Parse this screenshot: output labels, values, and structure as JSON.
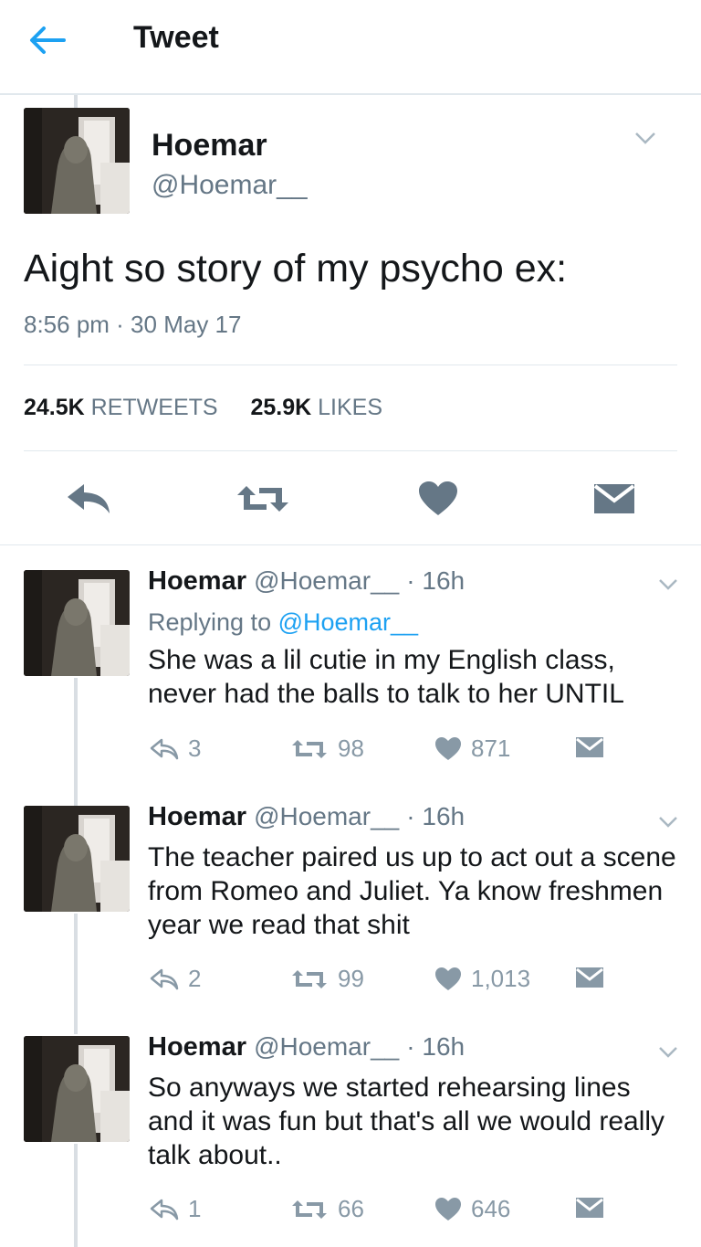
{
  "header": {
    "title": "Tweet"
  },
  "main_tweet": {
    "name": "Hoemar",
    "handle": "@Hoemar__",
    "text": "Aight so story of my psycho ex:",
    "time": "8:56 pm · 30 May 17",
    "retweets_count": "24.5K",
    "retweets_label": "RETWEETS",
    "likes_count": "25.9K",
    "likes_label": "LIKES"
  },
  "replies": [
    {
      "name": "Hoemar",
      "handle": "@Hoemar__",
      "time": "· 16h",
      "replying_prefix": "Replying to ",
      "replying_mention": "@Hoemar__",
      "text": "She was a lil cutie in my English class, never had the balls to talk to her UNTIL",
      "reply_count": "3",
      "retweet_count": "98",
      "like_count": "871"
    },
    {
      "name": "Hoemar",
      "handle": "@Hoemar__",
      "time": "· 16h",
      "text": "The teacher paired us up to act out a scene from Romeo and Juliet. Ya know freshmen year we read that shit",
      "reply_count": "2",
      "retweet_count": "99",
      "like_count": "1,013"
    },
    {
      "name": "Hoemar",
      "handle": "@Hoemar__",
      "time": "· 16h",
      "text": "So anyways we started rehearsing lines and it was fun but that's all we would really talk about..",
      "reply_count": "1",
      "retweet_count": "66",
      "like_count": "646"
    }
  ],
  "icons": {
    "back": "arrow-left-icon",
    "reply": "reply-icon",
    "retweet": "retweet-icon",
    "like": "heart-icon",
    "message": "envelope-icon",
    "more": "chevron-down-icon"
  },
  "colors": {
    "accent": "#1da1f2",
    "muted": "#657786",
    "icon_gray": "#8899a6",
    "icon_dark": "#657786"
  }
}
